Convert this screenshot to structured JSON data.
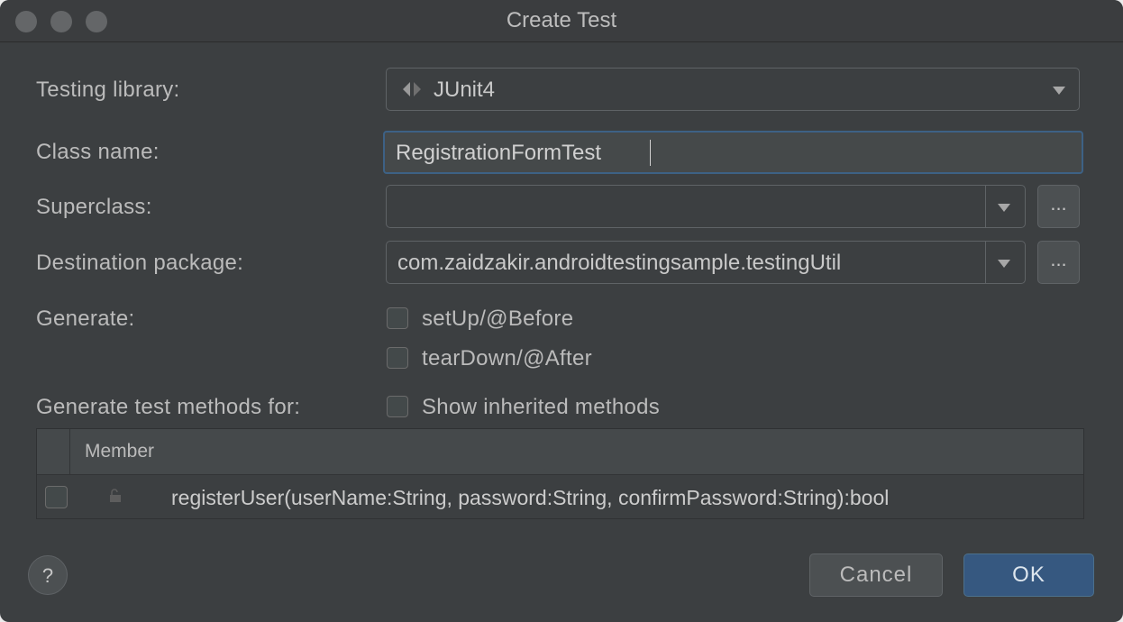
{
  "window": {
    "title": "Create Test"
  },
  "form": {
    "testing_library_label": "Testing library:",
    "testing_library_value": "JUnit4",
    "class_name_label": "Class name:",
    "class_name_value": "RegistrationFormTest",
    "superclass_label": "Superclass:",
    "superclass_value": "",
    "destination_package_label": "Destination package:",
    "destination_package_value": "com.zaidzakir.androidtestingsample.testingUtil",
    "browse_label": "...",
    "generate_label": "Generate:",
    "setup_label": "setUp/@Before",
    "teardown_label": "tearDown/@After",
    "generate_methods_label": "Generate test methods for:",
    "show_inherited_label": "Show inherited methods"
  },
  "table": {
    "header": "Member",
    "rows": [
      {
        "member": "registerUser(userName:String, password:String, confirmPassword:String):bool",
        "checked": false
      }
    ]
  },
  "footer": {
    "help_label": "?",
    "cancel_label": "Cancel",
    "ok_label": "OK"
  },
  "colors": {
    "accent": "#365880",
    "background": "#3c3f41",
    "text": "#bbbbbb"
  }
}
